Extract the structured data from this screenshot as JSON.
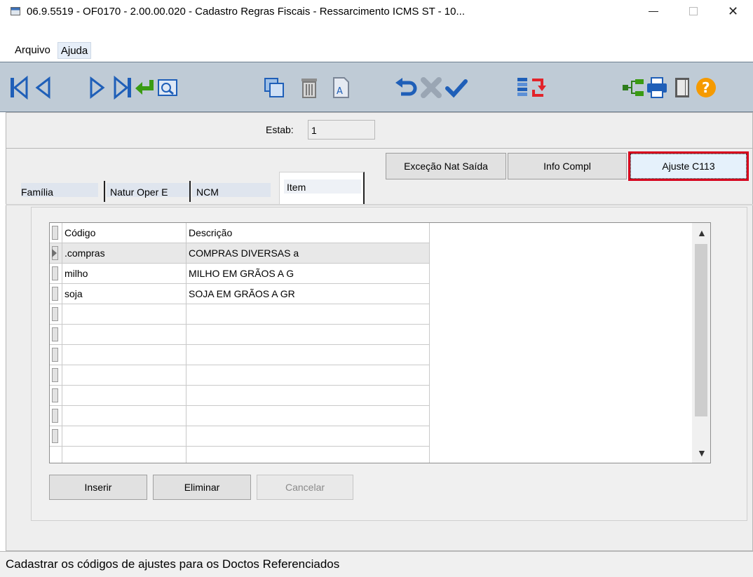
{
  "window": {
    "title": "06.9.5519 - OF0170 - 2.00.00.020 - Cadastro Regras Fiscais - Ressarcimento ICMS ST - 10...",
    "close_glyph": "✕"
  },
  "menu": {
    "items": [
      "Arquivo",
      "Ajuda"
    ]
  },
  "toolbar": {
    "icons": [
      "first-record-icon",
      "previous-record-icon",
      "next-record-icon",
      "last-record-icon",
      "goto-icon",
      "search-icon",
      "copy-icon",
      "delete-icon",
      "edit-icon",
      "undo-icon",
      "cancel-icon",
      "confirm-icon",
      "list-icon",
      "refresh-icon",
      "tree-icon",
      "print-icon",
      "exit-icon",
      "help-icon"
    ]
  },
  "estab": {
    "label": "Estab:",
    "value": "1"
  },
  "actions": {
    "excecao": "Exceção Nat Saída",
    "info": "Info Compl",
    "ajuste": "Ajuste C113"
  },
  "tabs": [
    "Família",
    "Natur Oper E",
    "NCM",
    "Item"
  ],
  "grid": {
    "headers": [
      "Código",
      "Descrição"
    ],
    "rows": [
      {
        "codigo": ".compras",
        "descricao": "COMPRAS DIVERSAS a"
      },
      {
        "codigo": "milho",
        "descricao": "MILHO EM GRÃOS A G"
      },
      {
        "codigo": "soja",
        "descricao": "SOJA EM GRÃOS A GR"
      }
    ]
  },
  "buttons": {
    "inserir": "Inserir",
    "eliminar": "Eliminar",
    "cancelar": "Cancelar"
  },
  "status": "Cadastrar os códigos de ajustes para os Doctos Referenciados",
  "colors": {
    "toolbar_bg": "#bfcbd6",
    "highlight_border": "#d6001c",
    "icon_blue": "#1f5fb8",
    "help_orange": "#f59a00"
  }
}
